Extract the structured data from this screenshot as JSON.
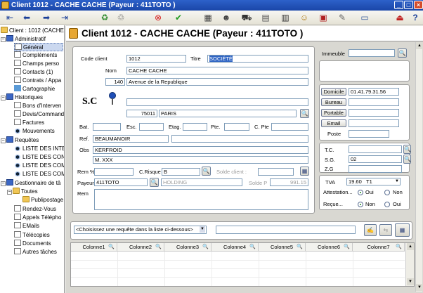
{
  "window": {
    "title": "Client 1012 - CACHE CACHE (Payeur : 411TOTO )"
  },
  "toolbar": {
    "icons": [
      "first-arrow-icon",
      "prev-arrow-icon",
      "next-arrow-icon",
      "last-arrow-icon",
      "recycle-icon",
      "recycle-alt-icon",
      "delete-icon",
      "validate-icon",
      "grid-icon",
      "user-icon",
      "train-icon",
      "document-icon",
      "film-icon",
      "profile-icon",
      "gift-icon",
      "notes-icon",
      "chart-icon",
      "exit-icon",
      "help-icon"
    ]
  },
  "tree": {
    "root": "Client : 1012 (CACHE C",
    "sections": [
      {
        "label": "Administratif",
        "items": [
          "Général",
          "Compléments",
          "Champs perso",
          "Contacts (1)",
          "Contrats / Appa",
          "Cartographie"
        ]
      },
      {
        "label": "Historiques",
        "items": [
          "Bons d'Interven",
          "Devis/Command",
          "Factures",
          "Mouvements"
        ]
      },
      {
        "label": "Requêtes",
        "items": [
          "LISTE DES INTEF",
          "LISTE DES CONT",
          "LISTE DES COMA",
          "LISTE DES COMA"
        ]
      },
      {
        "label": "Gestionnaire de tâ",
        "items": [
          "Toutes",
          "Publipostage",
          "Rendez-Vous",
          "Appels Télépho",
          "EMails",
          "Télécopies",
          "Documents",
          "Autres tâches"
        ]
      }
    ]
  },
  "header": {
    "title": "Client 1012 - CACHE CACHE (Payeur : 411TOTO )"
  },
  "form": {
    "code_client_label": "Code client",
    "code_client": "1012",
    "titre_label": "Titre",
    "titre": "SOCIÉTÉ",
    "nom_label": "Nom",
    "nom": "CACHE CACHE",
    "num": "140",
    "rue": "Avenue de la Republique",
    "abbr": "S.C",
    "addr2": "",
    "cp": "75011",
    "ville": "PARIS",
    "bat_label": "Bat.",
    "esc_label": "Esc.",
    "etag_label": "Etag.",
    "pte_label": "Pte.",
    "cpte_label": "C. Pte",
    "ref_label": "Ref.",
    "ref": "BEAUMANOIR",
    "obs_label": "Obs",
    "obs1": "KERFROID",
    "obs2": "M. XXX",
    "rem_pct_label": "Rem %",
    "crisque_label": "C.Risque",
    "crisque": "B",
    "solde_client_label": "Solde client :",
    "payeur_label": "Payeur",
    "payeur": "411TOTO",
    "payeur_nom": "HOLDING",
    "solde_p_label": "Solde P",
    "solde_p": "991.15",
    "rem_label": "Rem"
  },
  "right": {
    "immeuble_label": "Immeuble",
    "domicile_label": "Domicile",
    "domicile": "01.41.79.31.56",
    "bureau_label": "Bureau",
    "portable_label": "Portable",
    "email_label": "Email",
    "poste_label": "Poste",
    "tc_label": "T.C.",
    "sg_label": "S.G.",
    "sg": "02",
    "zg_label": "Z.G",
    "tva_label": "TVA",
    "tva_value": "19.60",
    "tva_code": "T1",
    "attestation_label": "Attestation...",
    "oui": "Oui",
    "non": "Non",
    "recue_label": "Reçue..."
  },
  "query": {
    "placeholder": "<Choisissez une requête dans la liste ci-dessous>"
  },
  "grid": {
    "columns": [
      "Colonne1",
      "Colonne2",
      "Colonne3",
      "Colonne4",
      "Colonne5",
      "Colonne6",
      "Colonne7"
    ]
  }
}
